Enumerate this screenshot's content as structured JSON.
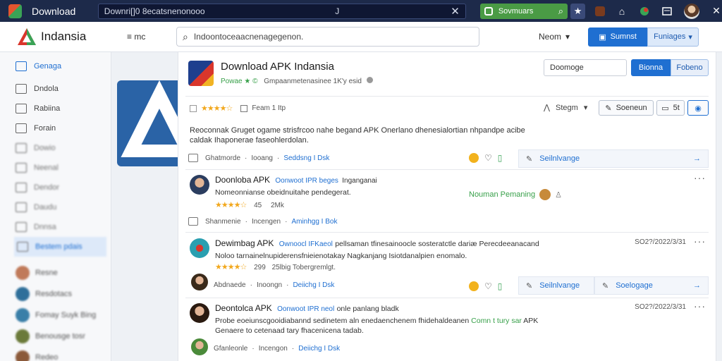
{
  "topbar": {
    "app_title": "Download",
    "url": "Downri[]0 8ecatsnenonooo",
    "url_cursor": "J",
    "search_label": "Sovmuars"
  },
  "header": {
    "brand": "Indansia",
    "menu": "≡ mc",
    "search_placeholder": "Indoontoceaacnenagegenon.",
    "news_label": "Neom",
    "btn_primary": "Sumnst",
    "btn_secondary": "Funiages"
  },
  "sidebar": {
    "items": [
      {
        "label": "Genaga"
      },
      {
        "label": "Dndola"
      },
      {
        "label": "Rabiina"
      },
      {
        "label": "Forain"
      },
      {
        "label": "Dowio"
      },
      {
        "label": "Neenal"
      },
      {
        "label": "Dendor"
      },
      {
        "label": "Daudu"
      },
      {
        "label": "Dnnsa"
      },
      {
        "label": "Bestem pdais"
      }
    ],
    "people": [
      {
        "name": "Resne"
      },
      {
        "name": "Resdotacs"
      },
      {
        "name": "Fomay Suyk Bing"
      },
      {
        "name": "Benousge tosr"
      },
      {
        "name": "Redeo"
      }
    ]
  },
  "app": {
    "title": "Download APK Indansia",
    "sub_green": "Powae ★ ©",
    "sub_text": "Gmpaanmetenasinee 1K'y esid",
    "input_label": "Doomoge",
    "btn_blue": "Bionna",
    "btn_light": "Fobeno",
    "rating_stars": "★★★★☆",
    "date_label": "Feam 1 Itp",
    "sort_label": "Stegm",
    "tool_btn_1": "Soeneun",
    "tool_btn_2": "5t",
    "description": "Reoconnak Gruget ogame strisfrcoo nahe begand APK Onerlano dhenesialortian nhpandpe acibe caldak Ihaponerae faseohlerdolan.",
    "actions": {
      "share": "Ghatmorde",
      "reply": "Iooang",
      "link": "Seddsng I Dsk",
      "edit_bar": "Seilnlvange"
    }
  },
  "posts": [
    {
      "title": "Doonloba APK",
      "tag": "Oonwoot IPR beges",
      "tag2": "Inganganai",
      "body": "Nomeonnianse obeidnuitahe pendegerat.",
      "rating": "★★★★☆",
      "count": "45",
      "count2": "2Mk",
      "side_text": "Nouman Pemaning",
      "share": "Shanmenie",
      "reply": "Incengen",
      "link": "Aminhgg I Bok"
    },
    {
      "title": "Dewimbag APK",
      "tag": "Ownoocl IFKaeol",
      "body_1": "pellsaman tfinesainoocle sosteratctle dariæ Perecdeeanacand",
      "body_2": "Noloo tarnainelnupiderensfnieienotakay Nagkanjang Isiotdanalpien enomalo.",
      "rating": "★★★★☆",
      "count": "299",
      "count2": "25lbig Tobergremlgt.",
      "date": "SO2?/2022/3/31",
      "share": "Abdnaede",
      "reply": "Inoongn",
      "link": "Deiichg I Dsk",
      "edit_bar_1": "Seilnlvange",
      "edit_bar_2": "Soelogage"
    },
    {
      "title": "Deontolca APK",
      "tag": "Oonwoot IPR neol",
      "tag2": "onle panlang bladk",
      "body_1": "Probe eoeiunscgooidiabannd sedinetem aln enedaenchenem fhidehaldeanen",
      "body_green": "Comn t tury sar",
      "body_1b": "APK",
      "body_2": "Genaere to cetenaad tary fhacenicena tadab.",
      "date": "SO2?/2022/3/31",
      "share": "Gfanleonle",
      "reply": "Incengon",
      "link": "Deiichg I Dsk"
    }
  ]
}
